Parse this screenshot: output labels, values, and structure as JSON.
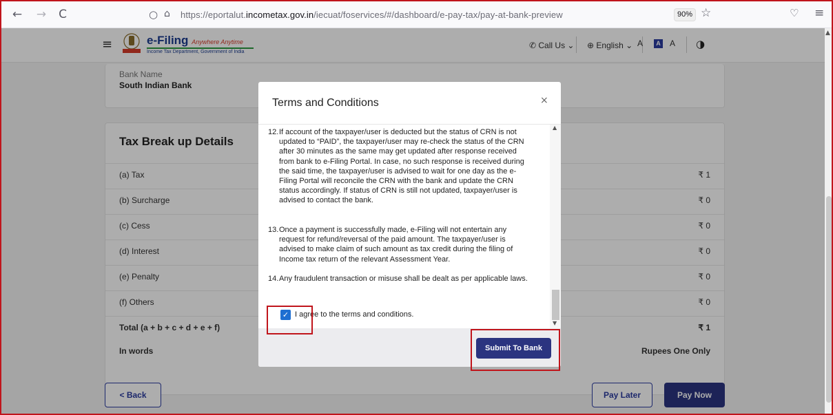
{
  "browser": {
    "back_icon": "←",
    "forward_icon": "→",
    "reload_icon": "C",
    "url_prefix": "https://eportalut.",
    "url_domain": "incometax.gov.in",
    "url_path": "/iecuat/foservices/#/dashboard/e-pay-tax/pay-at-bank-preview",
    "zoom": "90%"
  },
  "header": {
    "logo_title": "e-Filing",
    "logo_tagline": "Anywhere Anytime",
    "logo_subtitle": "Income Tax Department, Government of India",
    "call_us": "Call Us",
    "language": "English",
    "font_decrease": "A",
    "font_normal": "A",
    "font_increase": "A"
  },
  "bank": {
    "label": "Bank Name",
    "value": "South Indian Bank"
  },
  "tax_breakup": {
    "title": "Tax Break up Details",
    "rows": [
      {
        "label": "(a) Tax",
        "value": "₹ 1"
      },
      {
        "label": "(b) Surcharge",
        "value": "₹ 0"
      },
      {
        "label": "(c) Cess",
        "value": "₹ 0"
      },
      {
        "label": "(d) Interest",
        "value": "₹ 0"
      },
      {
        "label": "(e) Penalty",
        "value": "₹ 0"
      },
      {
        "label": "(f) Others",
        "value": "₹ 0"
      }
    ],
    "total_label": "Total (a + b + c + d + e + f)",
    "total_value": "₹ 1",
    "words_label": "In words",
    "words_value": "Rupees One Only"
  },
  "actions": {
    "back": "< Back",
    "pay_later": "Pay Later",
    "pay_now": "Pay Now"
  },
  "modal": {
    "title": "Terms and Conditions",
    "close": "×",
    "terms": [
      {
        "num": "12.",
        "text": "If account of the taxpayer/user is deducted but the status of CRN is not updated to “PAID”, the taxpayer/user may re-check the status of the CRN after 30 minutes as the same may get updated after response received from bank to e-Filing Portal. In case, no such response is received during the said time, the taxpayer/user is advised to wait for one day as the e-Filing Portal will reconcile the CRN with the bank and update the CRN status accordingly. If status of CRN is still not updated, taxpayer/user is advised to contact the bank."
      },
      {
        "num": "13.",
        "text": "Once a payment is successfully made, e-Filing will not entertain any request for refund/reversal of the paid amount. The taxpayer/user is advised to make claim of such amount as tax credit during the filing of Income tax return of the relevant Assessment Year."
      },
      {
        "num": "14.",
        "text": "Any fraudulent transaction or misuse shall be dealt as per applicable laws."
      }
    ],
    "agree_label": "I agree to the terms and conditions.",
    "agree_checked": true,
    "submit": "Submit To Bank"
  },
  "colors": {
    "primary": "#2b3480",
    "checkbox": "#1f6fd1",
    "highlight": "#c0141b"
  }
}
